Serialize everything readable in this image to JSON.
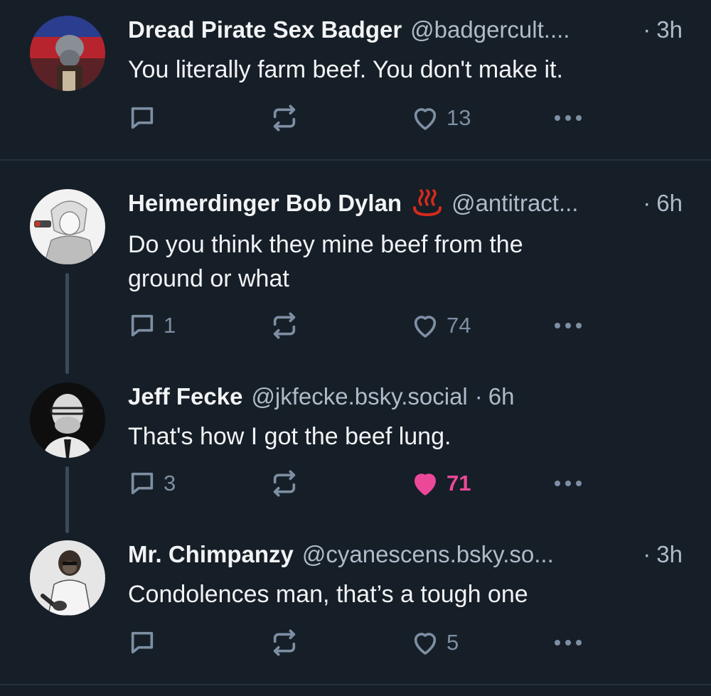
{
  "posts": [
    {
      "name": "Dread Pirate Sex Badger",
      "handle": "@badgercult....",
      "dot": "·",
      "time": "3h",
      "text": "You literally farm beef. You don't make it.",
      "replies": "",
      "likes": "13",
      "liked": false
    },
    {
      "name": "Heimerdinger Bob Dylan",
      "emoji": "hot-springs-icon",
      "handle": "@antitract...",
      "dot": "·",
      "time": "6h",
      "text": "Do you think they mine beef from the ground or what",
      "replies": "1",
      "likes": "74",
      "liked": false
    },
    {
      "name": "Jeff Fecke",
      "handle": "@jkfecke.bsky.social",
      "dot": "·",
      "time": "6h",
      "text": "That's how I got the beef lung.",
      "replies": "3",
      "likes": "71",
      "liked": true
    },
    {
      "name": "Mr. Chimpanzy",
      "handle": "@cyanescens.bsky.so...",
      "dot": "·",
      "time": "3h",
      "text": "Condolences man, that’s a tough one",
      "replies": "",
      "likes": "5",
      "liked": false
    }
  ],
  "colors": {
    "background": "#161e27",
    "muted": "#7d8fa3",
    "handle": "#aebbc9",
    "like_active": "#ec4899",
    "thread_line": "#3b4a5b"
  }
}
